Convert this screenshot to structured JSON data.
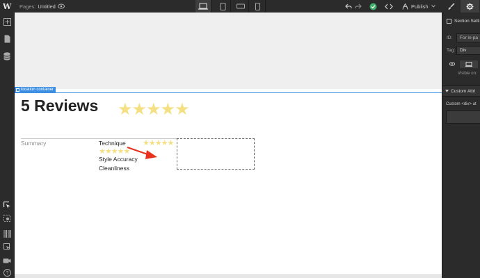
{
  "topbar": {
    "logo": "W",
    "pages_label": "Pages:",
    "page_name": "Untitled",
    "publish_label": "Publish"
  },
  "canvas": {
    "selection_tag": "location container",
    "reviews_title": "5 Reviews",
    "big_stars": "★★★★★",
    "summary_label": "Summary",
    "rows": [
      {
        "label": "Technique",
        "stars": "★★★★★"
      },
      {
        "label": "",
        "stars": "★★★★★"
      },
      {
        "label": "Style Accuracy",
        "stars": ""
      },
      {
        "label": "Cleanliness",
        "stars": ""
      }
    ],
    "annotation_color": "#e8321e"
  },
  "right_panel": {
    "section_label": "Section Setti",
    "id_label": "ID:",
    "id_placeholder": "For in-pa",
    "tag_label": "Tag:",
    "tag_value": "Div",
    "visible_on": "Visible on:",
    "custom_attrs_header": "Custom Attri",
    "custom_div_text": "Custom <div> at"
  },
  "colors": {
    "accent": "#3d8fe3",
    "star": "#f4df83",
    "publish_check": "#3fae6a"
  }
}
